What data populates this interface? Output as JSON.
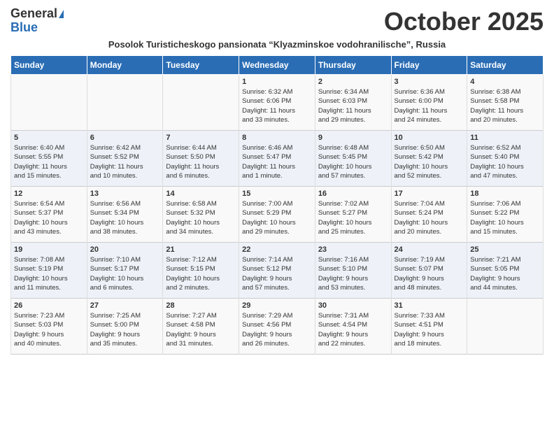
{
  "header": {
    "logo_general": "General",
    "logo_blue": "Blue",
    "month_title": "October 2025",
    "subtitle": "Posolok Turisticheskogo pansionata “Klyazminskoe vodohranilische”, Russia"
  },
  "days_of_week": [
    "Sunday",
    "Monday",
    "Tuesday",
    "Wednesday",
    "Thursday",
    "Friday",
    "Saturday"
  ],
  "weeks": [
    {
      "cells": [
        {
          "day": "",
          "content": ""
        },
        {
          "day": "",
          "content": ""
        },
        {
          "day": "",
          "content": ""
        },
        {
          "day": "1",
          "content": "Sunrise: 6:32 AM\nSunset: 6:06 PM\nDaylight: 11 hours\nand 33 minutes."
        },
        {
          "day": "2",
          "content": "Sunrise: 6:34 AM\nSunset: 6:03 PM\nDaylight: 11 hours\nand 29 minutes."
        },
        {
          "day": "3",
          "content": "Sunrise: 6:36 AM\nSunset: 6:00 PM\nDaylight: 11 hours\nand 24 minutes."
        },
        {
          "day": "4",
          "content": "Sunrise: 6:38 AM\nSunset: 5:58 PM\nDaylight: 11 hours\nand 20 minutes."
        }
      ]
    },
    {
      "cells": [
        {
          "day": "5",
          "content": "Sunrise: 6:40 AM\nSunset: 5:55 PM\nDaylight: 11 hours\nand 15 minutes."
        },
        {
          "day": "6",
          "content": "Sunrise: 6:42 AM\nSunset: 5:52 PM\nDaylight: 11 hours\nand 10 minutes."
        },
        {
          "day": "7",
          "content": "Sunrise: 6:44 AM\nSunset: 5:50 PM\nDaylight: 11 hours\nand 6 minutes."
        },
        {
          "day": "8",
          "content": "Sunrise: 6:46 AM\nSunset: 5:47 PM\nDaylight: 11 hours\nand 1 minute."
        },
        {
          "day": "9",
          "content": "Sunrise: 6:48 AM\nSunset: 5:45 PM\nDaylight: 10 hours\nand 57 minutes."
        },
        {
          "day": "10",
          "content": "Sunrise: 6:50 AM\nSunset: 5:42 PM\nDaylight: 10 hours\nand 52 minutes."
        },
        {
          "day": "11",
          "content": "Sunrise: 6:52 AM\nSunset: 5:40 PM\nDaylight: 10 hours\nand 47 minutes."
        }
      ]
    },
    {
      "cells": [
        {
          "day": "12",
          "content": "Sunrise: 6:54 AM\nSunset: 5:37 PM\nDaylight: 10 hours\nand 43 minutes."
        },
        {
          "day": "13",
          "content": "Sunrise: 6:56 AM\nSunset: 5:34 PM\nDaylight: 10 hours\nand 38 minutes."
        },
        {
          "day": "14",
          "content": "Sunrise: 6:58 AM\nSunset: 5:32 PM\nDaylight: 10 hours\nand 34 minutes."
        },
        {
          "day": "15",
          "content": "Sunrise: 7:00 AM\nSunset: 5:29 PM\nDaylight: 10 hours\nand 29 minutes."
        },
        {
          "day": "16",
          "content": "Sunrise: 7:02 AM\nSunset: 5:27 PM\nDaylight: 10 hours\nand 25 minutes."
        },
        {
          "day": "17",
          "content": "Sunrise: 7:04 AM\nSunset: 5:24 PM\nDaylight: 10 hours\nand 20 minutes."
        },
        {
          "day": "18",
          "content": "Sunrise: 7:06 AM\nSunset: 5:22 PM\nDaylight: 10 hours\nand 15 minutes."
        }
      ]
    },
    {
      "cells": [
        {
          "day": "19",
          "content": "Sunrise: 7:08 AM\nSunset: 5:19 PM\nDaylight: 10 hours\nand 11 minutes."
        },
        {
          "day": "20",
          "content": "Sunrise: 7:10 AM\nSunset: 5:17 PM\nDaylight: 10 hours\nand 6 minutes."
        },
        {
          "day": "21",
          "content": "Sunrise: 7:12 AM\nSunset: 5:15 PM\nDaylight: 10 hours\nand 2 minutes."
        },
        {
          "day": "22",
          "content": "Sunrise: 7:14 AM\nSunset: 5:12 PM\nDaylight: 9 hours\nand 57 minutes."
        },
        {
          "day": "23",
          "content": "Sunrise: 7:16 AM\nSunset: 5:10 PM\nDaylight: 9 hours\nand 53 minutes."
        },
        {
          "day": "24",
          "content": "Sunrise: 7:19 AM\nSunset: 5:07 PM\nDaylight: 9 hours\nand 48 minutes."
        },
        {
          "day": "25",
          "content": "Sunrise: 7:21 AM\nSunset: 5:05 PM\nDaylight: 9 hours\nand 44 minutes."
        }
      ]
    },
    {
      "cells": [
        {
          "day": "26",
          "content": "Sunrise: 7:23 AM\nSunset: 5:03 PM\nDaylight: 9 hours\nand 40 minutes."
        },
        {
          "day": "27",
          "content": "Sunrise: 7:25 AM\nSunset: 5:00 PM\nDaylight: 9 hours\nand 35 minutes."
        },
        {
          "day": "28",
          "content": "Sunrise: 7:27 AM\nSunset: 4:58 PM\nDaylight: 9 hours\nand 31 minutes."
        },
        {
          "day": "29",
          "content": "Sunrise: 7:29 AM\nSunset: 4:56 PM\nDaylight: 9 hours\nand 26 minutes."
        },
        {
          "day": "30",
          "content": "Sunrise: 7:31 AM\nSunset: 4:54 PM\nDaylight: 9 hours\nand 22 minutes."
        },
        {
          "day": "31",
          "content": "Sunrise: 7:33 AM\nSunset: 4:51 PM\nDaylight: 9 hours\nand 18 minutes."
        },
        {
          "day": "",
          "content": ""
        }
      ]
    }
  ]
}
